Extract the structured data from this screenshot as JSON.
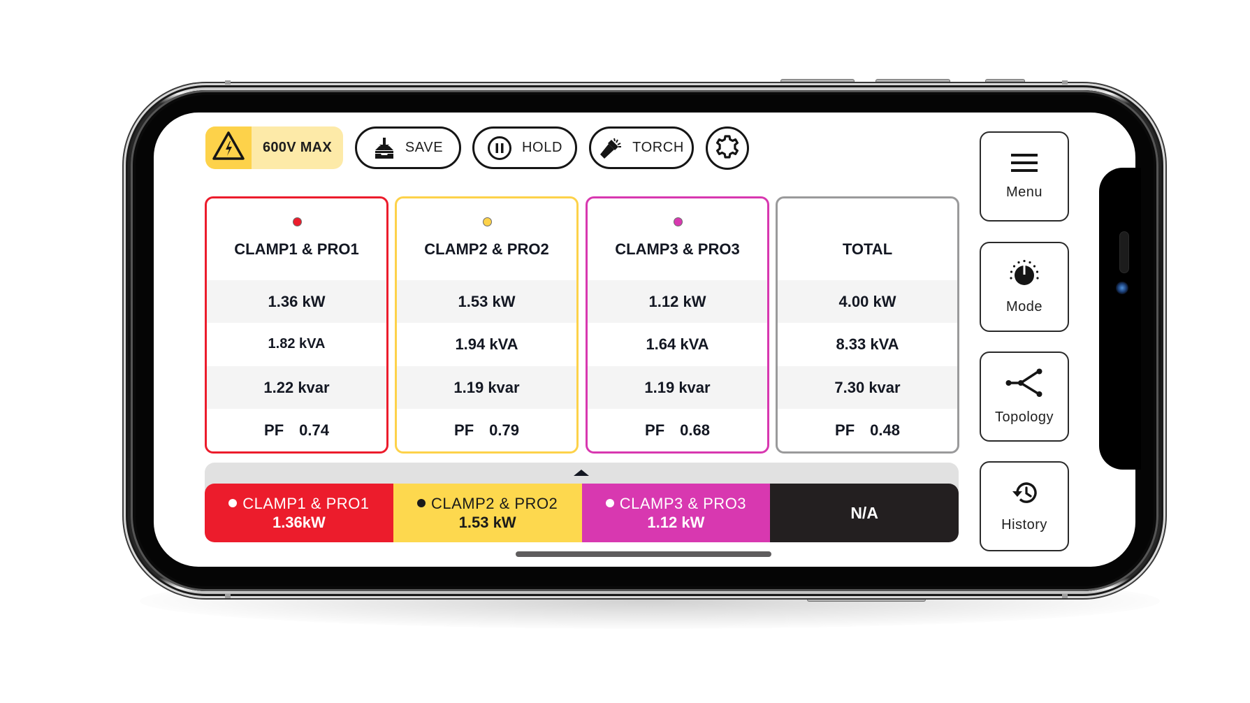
{
  "toolbar": {
    "voltage_badge": {
      "icon": "high-voltage-warning-icon",
      "label": "600V MAX"
    },
    "buttons": [
      {
        "id": "save",
        "icon": "save-tray-icon",
        "label": "SAVE"
      },
      {
        "id": "hold",
        "icon": "pause-circle-icon",
        "label": "HOLD"
      },
      {
        "id": "torch",
        "icon": "flashlight-icon",
        "label": "TORCH"
      },
      {
        "id": "settings",
        "icon": "gear-icon",
        "label": ""
      }
    ]
  },
  "colors": {
    "clamp1": "#ec1c2c",
    "clamp2": "#fdd24a",
    "clamp3": "#d838b0",
    "total": "#9a9a9b",
    "na": "#231f20",
    "badge_dark": "#fdd24a",
    "badge_light": "#fdeaa8"
  },
  "cards": [
    {
      "title": "CLAMP1 & PRO1",
      "kw": "1.36 kW",
      "kva": "1.82 kVA",
      "kvar": "1.22 kvar",
      "pf_label": "PF",
      "pf": "0.74",
      "has_dot": true
    },
    {
      "title": "CLAMP2 & PRO2",
      "kw": "1.53 kW",
      "kva": "1.94 kVA",
      "kvar": "1.19 kvar",
      "pf_label": "PF",
      "pf": "0.79",
      "has_dot": true
    },
    {
      "title": "CLAMP3 & PRO3",
      "kw": "1.12 kW",
      "kva": "1.64 kVA",
      "kvar": "1.19 kvar",
      "pf_label": "PF",
      "pf": "0.68",
      "has_dot": true
    },
    {
      "title": "TOTAL",
      "kw": "4.00 kW",
      "kva": "8.33 kVA",
      "kvar": "7.30 kvar",
      "pf_label": "PF",
      "pf": "0.48",
      "has_dot": false
    }
  ],
  "bottom_strip": {
    "segments": [
      {
        "name": "CLAMP1 & PRO1",
        "value": "1.36kW"
      },
      {
        "name": "CLAMP2 & PRO2",
        "value": "1.53 kW"
      },
      {
        "name": "CLAMP3 & PRO3",
        "value": "1.12 kW"
      },
      {
        "name": "",
        "value": "N/A"
      }
    ]
  },
  "nav": [
    {
      "icon": "hamburger-menu-icon",
      "label": "Menu"
    },
    {
      "icon": "mode-dial-icon",
      "label": "Mode"
    },
    {
      "icon": "topology-icon",
      "label": "Topology"
    },
    {
      "icon": "history-icon",
      "label": "History"
    }
  ]
}
